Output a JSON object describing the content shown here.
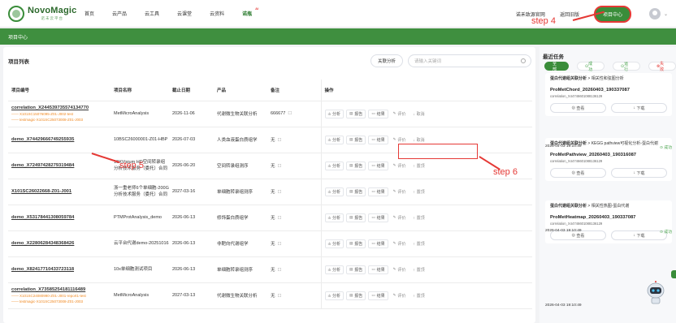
{
  "nav": {
    "logo_name": "NovoMagic",
    "logo_sub": "诺未云平台",
    "menu": [
      "首页",
      "云产品",
      "云工具",
      "云课堂",
      "云资料",
      "诺瓶"
    ],
    "ai_tag": "AI",
    "links": [
      "诺禾致源官网",
      "返回旧版"
    ],
    "center_btn": "项目中心",
    "avatar_chevron": "⌄"
  },
  "breadcrumb": "项目中心",
  "main": {
    "title": "项目列表",
    "assoc_btn": "关联分析",
    "search_placeholder": "请输入关键词",
    "headers": [
      "项目编号",
      "项目名称",
      "截止日期",
      "产品",
      "备注",
      "操作"
    ],
    "rows": [
      {
        "id": "correlation_X244539735574134770",
        "subs": [
          "X101SC15076095-Z01-J002-test",
          "testmagic-X101SC25073008-Z01-J003"
        ],
        "name": "MetMicroAnalysis",
        "date": "2026-11-06",
        "product": "代谢微生物关联分析",
        "note": "666677",
        "ops": [
          "分析",
          "报告",
          "结果",
          "评价",
          "取消"
        ]
      },
      {
        "id": "demo_X74429666749255935",
        "subs": [],
        "name": "10BSC26000001-Z01-HBP",
        "date": "2026-07-03",
        "product": "人类血液蛋白质组学",
        "note": "无",
        "ops": [
          "分析",
          "报告",
          "结果",
          "评价",
          "取消"
        ]
      },
      {
        "id": "demo_X72497428279319484",
        "subs": [],
        "name": "10XVisium HD空间转录组分析技术服务（委托）合同",
        "date": "2026-06-20",
        "product": "空间转录组测序",
        "note": "无",
        "ops": [
          "分析",
          "报告",
          "结果",
          "评价",
          "置顶"
        ]
      },
      {
        "id": "X101SC26022668-Z01-J001",
        "subs": [],
        "name": "浙一重老师6个单细胞-200G分析技术服务（委托）合同",
        "date": "2027-03-16",
        "product": "单细胞转录组测序",
        "note": "无",
        "ops": [
          "分析",
          "报告",
          "结果",
          "评价",
          "置顶"
        ]
      },
      {
        "id": "demo_X53178441308059784",
        "subs": [],
        "name": "PTMProtAnalysis_demo",
        "date": "2026-06-13",
        "product": "修饰蛋白质组学",
        "note": "无",
        "ops": [
          "分析",
          "报告",
          "结果",
          "评价",
          "置顶"
        ]
      },
      {
        "id": "demo_X22806284348368426",
        "subs": [],
        "name": "云平台代谢demo-20251016",
        "date": "2026-06-13",
        "product": "非靶向代谢组学",
        "note": "无",
        "ops": [
          "分析",
          "报告",
          "结果",
          "评价",
          "置顶"
        ]
      },
      {
        "id": "demo_X82417710433723118",
        "subs": [],
        "name": "10x单细胞测试项目",
        "date": "2026-06-13",
        "product": "单细胞转录组测序",
        "note": "无",
        "ops": [
          "分析",
          "报告",
          "结果",
          "评价",
          "置顶"
        ]
      },
      {
        "id": "correlation_X73585254181116489",
        "subs": [
          "X101SC24080990-Z01-J001-report1-test",
          "testmagic-X101SC25073008-Z01-J003"
        ],
        "name": "MetMicroAnalysis",
        "date": "2027-03-13",
        "product": "代谢微生物关联分析",
        "note": "无",
        "ops": [
          "分析",
          "报告",
          "结果",
          "评价",
          "置顶"
        ]
      }
    ]
  },
  "annotations": {
    "step4": "step 4",
    "step5": "step 5",
    "step6": "step 6"
  },
  "tasks": {
    "title": "最近任务",
    "filters": [
      "全部",
      "成功",
      "运行",
      "失败"
    ],
    "items": [
      {
        "category": "蛋白代谢组关联分析",
        "sub": "相关性和弦图分析",
        "name": "ProMetChord_20260403_190337087",
        "id": "correlation_X44746601088136129",
        "view": "查看",
        "download": "下载",
        "time": "2026-04-03 19:10:49",
        "status": "成功"
      },
      {
        "category": "蛋白代谢组关联分析",
        "sub": "KEGG pathview可视化分析-蛋白代谢",
        "name": "ProMetPathview_20260403_190316087",
        "id": "correlation_X44746601088136129",
        "view": "查看",
        "download": "下载",
        "time": "2026-04-03 19:10:49",
        "status": "成功"
      },
      {
        "category": "蛋白代谢组关联分析",
        "sub": "相关性热图-蛋白代谢",
        "name": "ProMetHeatmap_20260403_190337087",
        "id": "correlation_X44746601088136129",
        "view": "查看",
        "download": "下载",
        "time": "2026-04-03 19:10:49",
        "status": ""
      }
    ]
  },
  "colors": {
    "brand": "#3a8d3a",
    "accent_red": "#e53935",
    "orange": "#f08a24"
  }
}
